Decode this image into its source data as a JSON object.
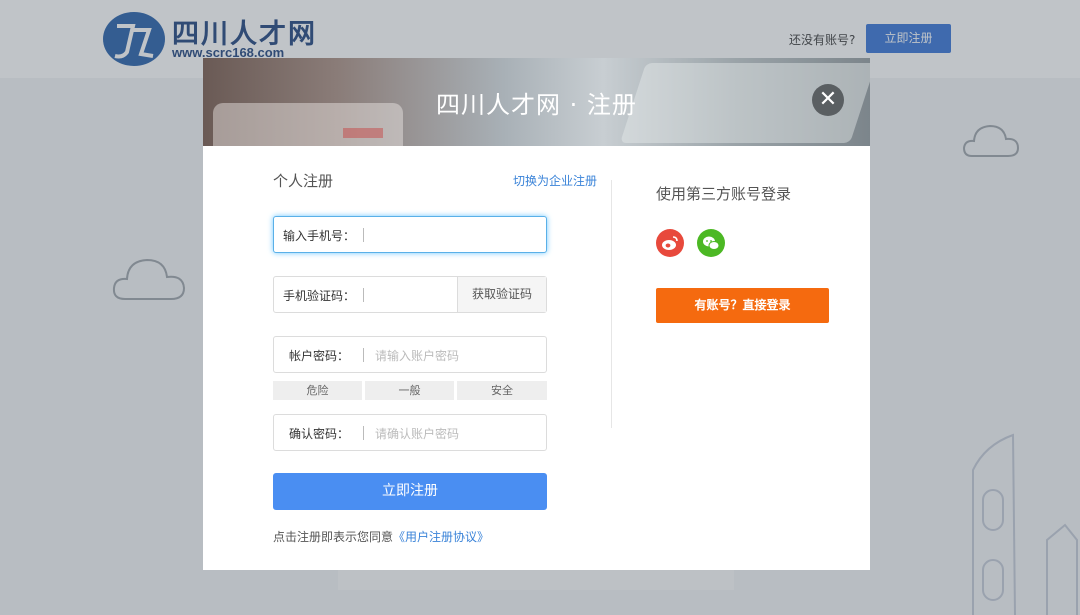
{
  "header": {
    "logo_name": "四川人才网",
    "logo_url": "www.scrc168.com",
    "no_account_text": "还没有账号?",
    "register_button": "立即注册"
  },
  "modal": {
    "title": "四川人才网 · 注册",
    "close_icon": "close-icon"
  },
  "personal": {
    "section_title": "个人注册",
    "switch_link": "切换为企业注册",
    "phone_label": "输入手机号：",
    "sms_label": "手机验证码：",
    "get_code_button": "获取验证码",
    "password_label": "帐户密码：",
    "password_placeholder": "请输入账户密码",
    "strength_levels": [
      "危险",
      "一般",
      "安全"
    ],
    "confirm_label": "确认密码：",
    "confirm_placeholder": "请确认账户密码",
    "submit_button": "立即注册",
    "agree_text": "点击注册即表示您同意",
    "agree_link": "《用户注册协议》"
  },
  "third_party": {
    "title": "使用第三方账号登录",
    "icons": [
      "weibo-icon",
      "wechat-icon"
    ],
    "colors": {
      "weibo": "#e8493c",
      "wechat": "#4cb824",
      "login": "#f56a0f",
      "submit": "#4a8ef2"
    },
    "login_button": "有账号？直接登录"
  }
}
